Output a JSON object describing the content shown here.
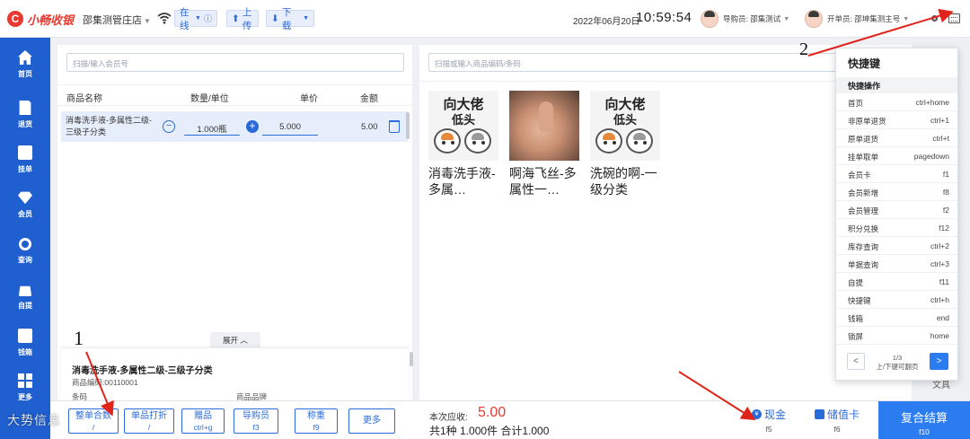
{
  "header": {
    "logo_mark": "C",
    "app_name": "小畅收银",
    "store": "邵集测管庄店",
    "online": "在线",
    "upload": "上传",
    "download": "下载",
    "date": "2022年06月20日",
    "time": "10:59:54",
    "guide": "导购员: 邵集测试",
    "opener": "开单员: 邵坤集测主号"
  },
  "sidebar": {
    "items": [
      {
        "label": "首页",
        "icon": "home-icon"
      },
      {
        "label": "退货",
        "icon": "return-icon"
      },
      {
        "label": "挂单",
        "icon": "hang-order-icon"
      },
      {
        "label": "会员",
        "icon": "diamond-icon"
      },
      {
        "label": "查询",
        "icon": "search-icon"
      },
      {
        "label": "自提",
        "icon": "bag-icon"
      },
      {
        "label": "钱箱",
        "icon": "cashbox-icon"
      },
      {
        "label": "更多",
        "icon": "grid-icon"
      }
    ]
  },
  "cart": {
    "member_placeholder": "扫描/输入会员号",
    "headers": {
      "name": "商品名称",
      "qty": "数量/单位",
      "price": "单价",
      "amount": "金额"
    },
    "rows": [
      {
        "name": "消毒洗手液-多属性二级-三级子分类",
        "qty": "1.000瓶",
        "price": "5.000",
        "amount": "5.00"
      }
    ],
    "expand": "展开",
    "detail": {
      "title": "消毒洗手液-多属性二级-三级子分类",
      "code": "商品编码:00110001",
      "tag1": "条码",
      "tag2": "商品品牌"
    }
  },
  "products": {
    "search_placeholder": "扫描或输入商品编码/条码",
    "items": [
      {
        "name": "消毒洗手液-多属…",
        "image": "meme-cat"
      },
      {
        "name": "啊海飞丝-多属性一…",
        "image": "thumbs-up-photo"
      },
      {
        "name": "洗碗的啊-一级分类",
        "image": "meme-cat"
      }
    ],
    "meme_line1": "向大佬",
    "meme_line2": "低头",
    "side_label": "文具"
  },
  "shortcuts": {
    "title": "快捷键",
    "section": "快捷操作",
    "rows": [
      {
        "k": "首页",
        "v": "ctrl+home"
      },
      {
        "k": "非原单退货",
        "v": "ctrl+1"
      },
      {
        "k": "原单退货",
        "v": "ctrl+t"
      },
      {
        "k": "挂单取单",
        "v": "pagedown"
      },
      {
        "k": "会员卡",
        "v": "f1"
      },
      {
        "k": "会员新增",
        "v": "f8"
      },
      {
        "k": "会员管理",
        "v": "f2"
      },
      {
        "k": "积分兑换",
        "v": "f12"
      },
      {
        "k": "库存查询",
        "v": "ctrl+2"
      },
      {
        "k": "单据查询",
        "v": "ctrl+3"
      },
      {
        "k": "自提",
        "v": "f11"
      },
      {
        "k": "快捷键",
        "v": "ctrl+h"
      },
      {
        "k": "钱箱",
        "v": "end"
      },
      {
        "k": "锁屏",
        "v": "home"
      }
    ],
    "page": "1/3",
    "page_hint": "上/下键可翻页",
    "prev": "<",
    "next": ">"
  },
  "bottom": {
    "buttons": [
      {
        "label": "整单合数",
        "key": "/"
      },
      {
        "label": "单品打折",
        "key": "/"
      },
      {
        "label": "赠品",
        "key": "ctrl+g"
      },
      {
        "label": "导购员",
        "key": "f3"
      },
      {
        "label": "称重",
        "key": "f9"
      },
      {
        "label": "更多",
        "key": ""
      }
    ],
    "due_label": "本次应收:",
    "due_value": "5.00",
    "summary": "共1种 1.000件 合计1.000",
    "cash": {
      "label": "现金",
      "key": "f5",
      "icon": "¥"
    },
    "stored": {
      "label": "储值卡",
      "key": "f6"
    },
    "checkout": {
      "label": "复合结算",
      "key": "f10"
    }
  },
  "annotations": {
    "one": "1",
    "two": "2",
    "watermark": "大势信息"
  },
  "colors": {
    "primary": "#2b6bd8",
    "sidebar": "#1f5fcf",
    "accent_red": "#e8382f",
    "checkout": "#2b7cf1",
    "annotation_arrow": "#e0241b"
  }
}
